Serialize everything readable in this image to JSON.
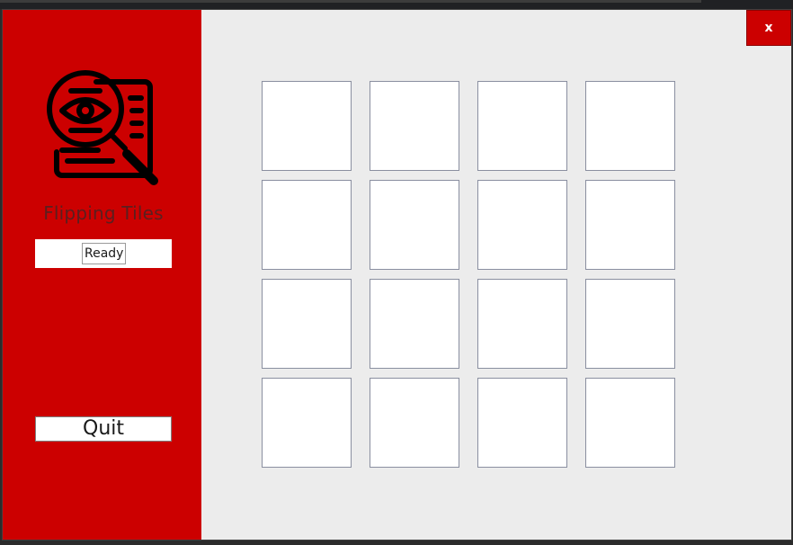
{
  "app": {
    "title": "Flipping Tiles",
    "status": "Ready",
    "quit_label": "Quit",
    "close_label": "x"
  },
  "icons": {
    "logo": "document-search-eye-icon"
  },
  "colors": {
    "sidebar": "#cc0000",
    "background": "#ececec",
    "tile": "#ffffff",
    "title_text": "#5a1f1f"
  },
  "tiles": [
    {
      "row": 1,
      "col": 1
    },
    {
      "row": 1,
      "col": 2
    },
    {
      "row": 1,
      "col": 3
    },
    {
      "row": 1,
      "col": 4
    },
    {
      "row": 2,
      "col": 1
    },
    {
      "row": 2,
      "col": 2
    },
    {
      "row": 2,
      "col": 3
    },
    {
      "row": 2,
      "col": 4
    },
    {
      "row": 3,
      "col": 1
    },
    {
      "row": 3,
      "col": 2
    },
    {
      "row": 3,
      "col": 3
    },
    {
      "row": 3,
      "col": 4
    },
    {
      "row": 4,
      "col": 1
    },
    {
      "row": 4,
      "col": 2
    },
    {
      "row": 4,
      "col": 3
    },
    {
      "row": 4,
      "col": 4
    }
  ]
}
